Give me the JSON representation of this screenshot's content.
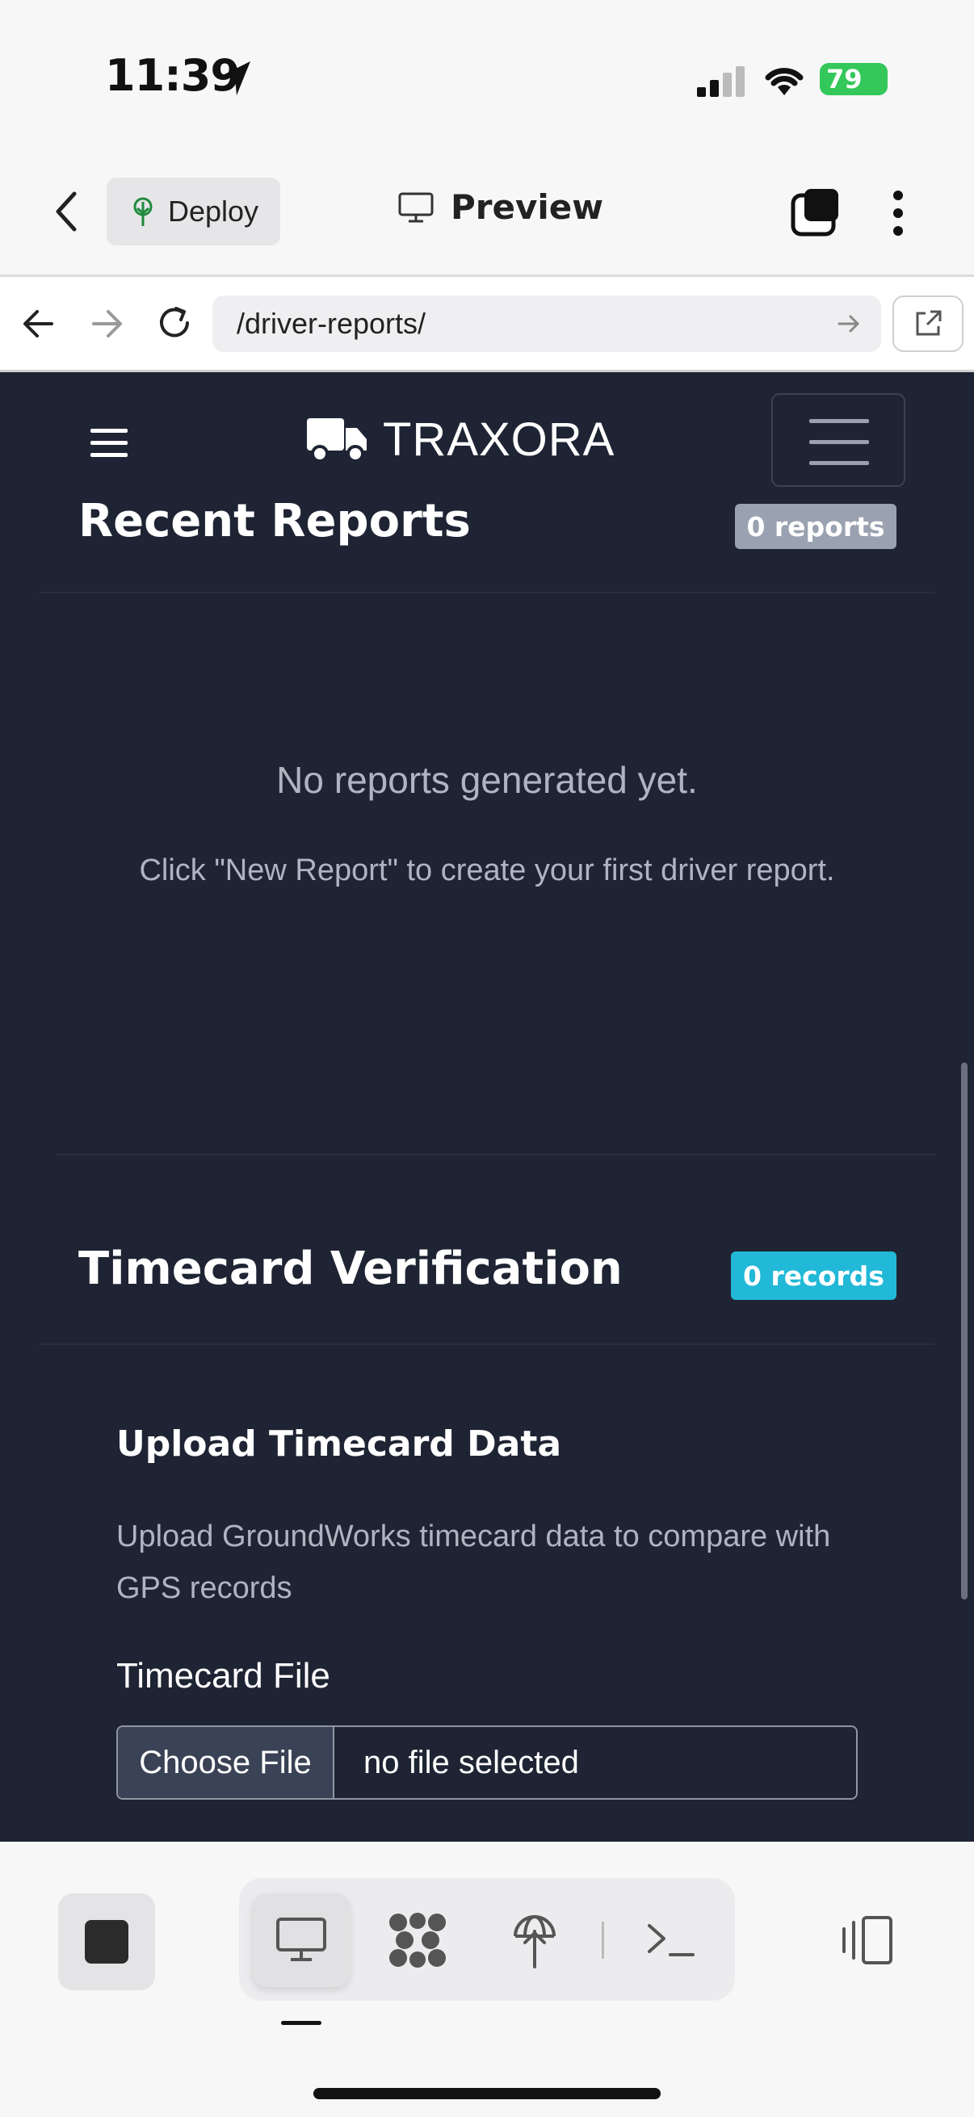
{
  "status_bar": {
    "time": "11:39",
    "battery": "79"
  },
  "header": {
    "deploy_label": "Deploy",
    "preview_label": "Preview"
  },
  "browser": {
    "url": "/driver-reports/"
  },
  "navbar": {
    "brand": "TRAXORA"
  },
  "recent_reports": {
    "title": "Recent Reports",
    "badge": "0 reports",
    "empty_title": "No reports generated yet.",
    "empty_hint": "Click \"New Report\" to create your first driver report."
  },
  "timecard": {
    "title": "Timecard Verification",
    "badge": "0 records",
    "upload_heading": "Upload Timecard Data",
    "upload_desc": "Upload GroundWorks timecard data to compare with GPS records",
    "file_label": "Timecard File",
    "file_button": "Choose File",
    "file_status": "no file selected"
  },
  "colors": {
    "badge_gray": "#9aa1b0",
    "badge_info": "#22b8d8",
    "page_bg": "#1e2433",
    "battery": "#34c759"
  },
  "icons": [
    "location-arrow-icon",
    "signal-icon",
    "wifi-icon",
    "battery-icon",
    "back-chevron-icon",
    "tree-icon",
    "monitor-icon",
    "tabs-icon",
    "more-vertical-icon",
    "arrow-left-icon",
    "arrow-right-icon",
    "reload-icon",
    "external-link-icon",
    "hamburger-icon",
    "truck-icon",
    "stop-icon",
    "network-icon",
    "deploy-globe-icon",
    "terminal-icon",
    "split-view-icon"
  ]
}
